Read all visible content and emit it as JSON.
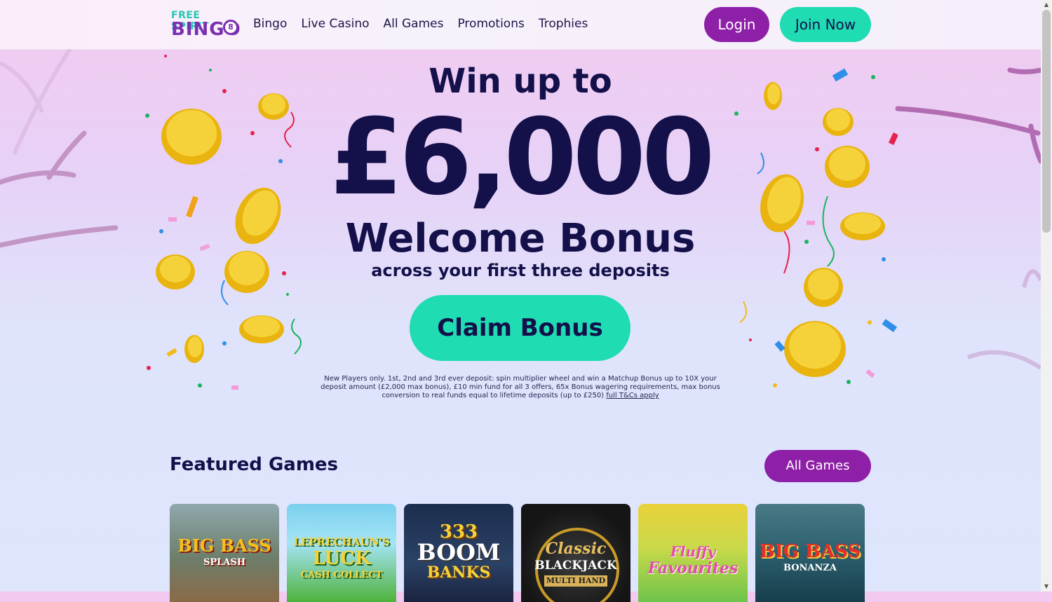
{
  "header": {
    "logo_top": "FREE SPIRIT",
    "logo_bottom": "BINGO",
    "logo_ball": "8",
    "nav": [
      "Bingo",
      "Live Casino",
      "All Games",
      "Promotions",
      "Trophies"
    ],
    "login_label": "Login",
    "join_label": "Join Now"
  },
  "hero": {
    "line1": "Win up to",
    "amount": "£6,000",
    "bonus": "Welcome Bonus",
    "sub": "across your first three deposits",
    "claim_label": "Claim Bonus",
    "terms_text": "New Players only. 1st, 2nd and 3rd ever deposit: spin multiplier wheel and win a Matchup Bonus up to 10X your deposit amount (£2,000 max bonus), £10 min fund for all 3 offers, 65x Bonus wagering requirements, max bonus conversion to real funds equal to lifetime deposits (up to £250)",
    "terms_link": "full T&Cs apply"
  },
  "featured": {
    "title": "Featured Games",
    "all_games_label": "All Games",
    "games": [
      {
        "line1": "BIG BASS",
        "line2": "SPLASH"
      },
      {
        "line1": "LEPRECHAUN'S",
        "line2": "LUCK",
        "line3": "CASH COLLECT"
      },
      {
        "line1": "333",
        "line2": "BOOM",
        "line3": "BANKS"
      },
      {
        "line1": "Classic",
        "line2": "BLACKJACK",
        "line3": "MULTI HAND"
      },
      {
        "line1": "Fluffy",
        "line2": "Favourites"
      },
      {
        "line1": "BIG BASS",
        "line2": "BONANZA"
      }
    ]
  },
  "colors": {
    "navy": "#13104a",
    "purple": "#8e1fa7",
    "teal": "#1fdcb3",
    "coin": "#f2c21b"
  }
}
